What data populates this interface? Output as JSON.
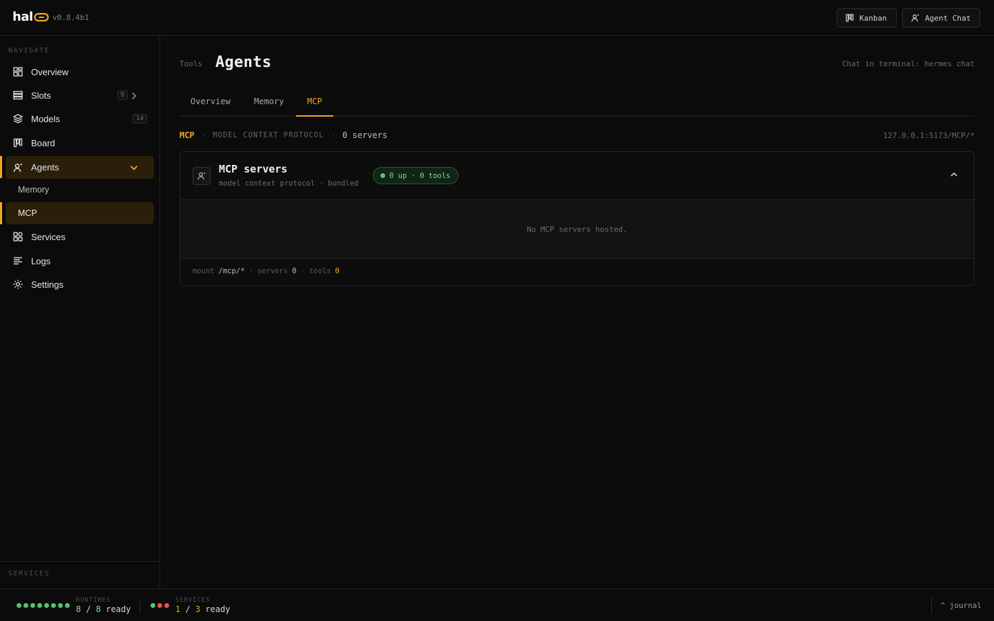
{
  "app": {
    "logo_text": "hal",
    "version": "v0.8.4b1"
  },
  "topbar": {
    "kanban_label": "Kanban",
    "agent_chat_label": "Agent Chat"
  },
  "sidebar": {
    "navigate_label": "NAVIGATE",
    "services_label": "SERVICES",
    "items": [
      {
        "label": "Overview",
        "icon": "grid-icon"
      },
      {
        "label": "Slots",
        "icon": "stack-icon",
        "badge": "9"
      },
      {
        "label": "Models",
        "icon": "layers-icon",
        "badge": "14"
      },
      {
        "label": "Board",
        "icon": "kanban-icon"
      },
      {
        "label": "Agents",
        "icon": "agent-icon"
      },
      {
        "label": "Services",
        "icon": "services-icon"
      },
      {
        "label": "Logs",
        "icon": "logs-icon"
      },
      {
        "label": "Settings",
        "icon": "gear-icon"
      }
    ],
    "subitems": [
      {
        "label": "Memory"
      },
      {
        "label": "MCP"
      }
    ]
  },
  "header": {
    "breadcrumb": "Tools",
    "title": "Agents",
    "hint": "Chat in terminal: hermes chat"
  },
  "tabs": [
    {
      "label": "Overview"
    },
    {
      "label": "Memory"
    },
    {
      "label": "MCP"
    }
  ],
  "mcp_line": {
    "key": "MCP",
    "sub": "MODEL CONTEXT PROTOCOL",
    "count": "0 servers",
    "address": "127.0.0.1:5173/MCP/*"
  },
  "card": {
    "title": "MCP servers",
    "subtitle": "model context protocol · bundled",
    "status": "0 up · 0 tools",
    "empty_message": "No MCP servers hosted.",
    "foot": {
      "mount_label": "mount",
      "mount_value": "/mcp/*",
      "servers_label": "servers",
      "servers_value": "0",
      "tools_label": "tools",
      "tools_value": "0"
    }
  },
  "bottombar": {
    "runtimes_label": "RUNTIMES",
    "runtimes_ready": "8",
    "runtimes_total": "8",
    "runtimes_suffix": "ready",
    "services_label": "SERVICES",
    "services_ready": "1",
    "services_total": "3",
    "services_suffix": "ready",
    "journal_label": "^ journal"
  },
  "colors": {
    "accent": "#f5a623",
    "ok": "#56c271",
    "error": "#e05555",
    "background": "#0b0b0b"
  }
}
